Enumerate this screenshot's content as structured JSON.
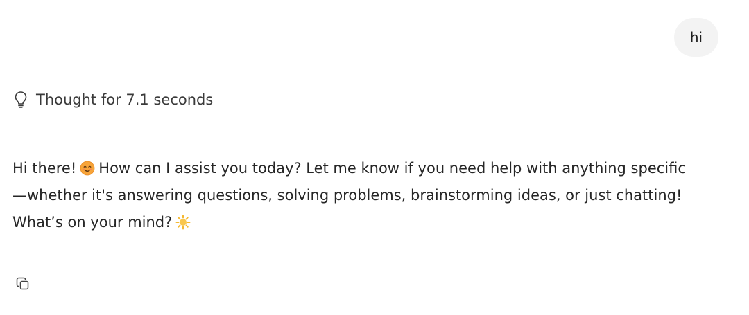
{
  "user_message": {
    "text": "hi"
  },
  "thought": {
    "label": "Thought for 7.1 seconds",
    "icon": "lightbulb-icon"
  },
  "assistant_message": {
    "part1": "Hi there!",
    "emoji1": "smiling-face-emoji",
    "part2": "How can I assist you today? Let me know if you need help with anything specific",
    "part3": "—whether it's answering questions, solving problems, brainstorming ideas, or just chatting!",
    "part4": "What’s on your mind?",
    "emoji2": "sun-emoji"
  },
  "actions": {
    "copy_icon": "copy-icon"
  },
  "colors": {
    "user_bubble_bg": "#f3f3f3",
    "text": "#262626",
    "muted_text": "#3a3a3a",
    "emoji_smile": "#f7a43a",
    "emoji_sun": "#f9c74f"
  }
}
